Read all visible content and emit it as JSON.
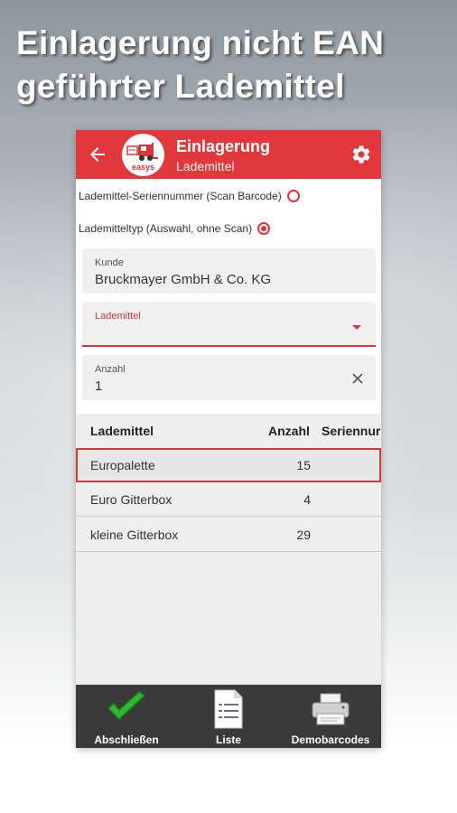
{
  "headline": {
    "line1": "Einlagerung nicht EAN",
    "line2": "geführter Lademittel"
  },
  "appbar": {
    "title": "Einlagerung",
    "subtitle": "Lademittel",
    "logo_text": "easys",
    "accent_color": "#e0383b"
  },
  "options": [
    {
      "label": "Lademittel-Seriennummer (Scan Barcode)",
      "checked": false
    },
    {
      "label": "Lademitteltyp (Auswahl, ohne Scan)",
      "checked": true
    }
  ],
  "fields": {
    "kunde": {
      "label": "Kunde",
      "value": "Bruckmayer GmbH & Co. KG"
    },
    "lademittel": {
      "label": "Lademittel",
      "value": ""
    },
    "anzahl": {
      "label": "Anzahl",
      "value": "1"
    }
  },
  "table": {
    "columns": [
      "Lademittel",
      "Anzahl",
      "Seriennur"
    ],
    "rows": [
      {
        "name": "Europalette",
        "count": "15",
        "selected": true
      },
      {
        "name": "Euro Gitterbox",
        "count": "4",
        "selected": false
      },
      {
        "name": "kleine Gitterbox",
        "count": "29",
        "selected": false
      }
    ]
  },
  "bottombar": {
    "items": [
      {
        "label": "Abschließen",
        "icon": "checkmark-icon"
      },
      {
        "label": "Liste",
        "icon": "document-list-icon"
      },
      {
        "label": "Demobarcodes",
        "icon": "printer-icon"
      }
    ]
  }
}
